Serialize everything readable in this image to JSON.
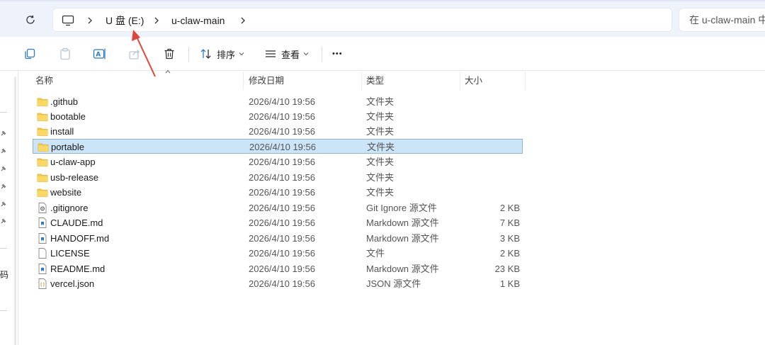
{
  "address": {
    "crumbs": [
      "U 盘 (E:)",
      "u-claw-main"
    ],
    "search_placeholder": "在 u-claw-main 中"
  },
  "toolbar": {
    "sort_label": "排序",
    "view_label": "查看",
    "more_label": "•••"
  },
  "nav": {
    "partial_text": "码"
  },
  "columns": {
    "name": "名称",
    "modified": "修改日期",
    "type": "类型",
    "size": "大小"
  },
  "files": [
    {
      "name": ".github",
      "date": "2026/4/10 19:56",
      "type": "文件夹",
      "size": "",
      "icon": "folder-icon"
    },
    {
      "name": "bootable",
      "date": "2026/4/10 19:56",
      "type": "文件夹",
      "size": "",
      "icon": "folder-icon"
    },
    {
      "name": "install",
      "date": "2026/4/10 19:56",
      "type": "文件夹",
      "size": "",
      "icon": "folder-icon"
    },
    {
      "name": "portable",
      "date": "2026/4/10 19:56",
      "type": "文件夹",
      "size": "",
      "icon": "folder-icon",
      "selected": true
    },
    {
      "name": "u-claw-app",
      "date": "2026/4/10 19:56",
      "type": "文件夹",
      "size": "",
      "icon": "folder-icon"
    },
    {
      "name": "usb-release",
      "date": "2026/4/10 19:56",
      "type": "文件夹",
      "size": "",
      "icon": "folder-icon"
    },
    {
      "name": "website",
      "date": "2026/4/10 19:56",
      "type": "文件夹",
      "size": "",
      "icon": "folder-icon"
    },
    {
      "name": ".gitignore",
      "date": "2026/4/10 19:56",
      "type": "Git Ignore 源文件",
      "size": "2 KB",
      "icon": "gear-file-icon"
    },
    {
      "name": "CLAUDE.md",
      "date": "2026/4/10 19:56",
      "type": "Markdown 源文件",
      "size": "7 KB",
      "icon": "markdown-file-icon"
    },
    {
      "name": "HANDOFF.md",
      "date": "2026/4/10 19:56",
      "type": "Markdown 源文件",
      "size": "3 KB",
      "icon": "markdown-file-icon"
    },
    {
      "name": "LICENSE",
      "date": "2026/4/10 19:56",
      "type": "文件",
      "size": "2 KB",
      "icon": "blank-file-icon"
    },
    {
      "name": "README.md",
      "date": "2026/4/10 19:56",
      "type": "Markdown 源文件",
      "size": "23 KB",
      "icon": "markdown-file-icon"
    },
    {
      "name": "vercel.json",
      "date": "2026/4/10 19:56",
      "type": "JSON 源文件",
      "size": "1 KB",
      "icon": "json-file-icon"
    }
  ],
  "colors": {
    "selection": "#cce4f7",
    "selection_border": "#8fb3d3",
    "folder": "#f7c94b",
    "annotation_arrow": "#e0443a"
  }
}
